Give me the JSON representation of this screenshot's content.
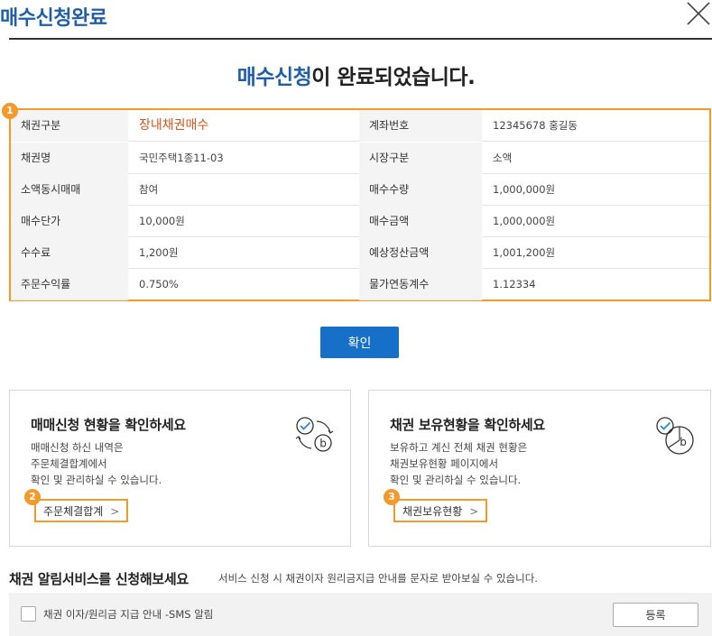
{
  "header": {
    "title": "매수신청완료",
    "close_icon": "close-icon"
  },
  "headline": {
    "accent": "매수신청",
    "rest": "이 완료되었습니다."
  },
  "info": {
    "badge": "1",
    "rows": [
      {
        "label1": "채권구분",
        "value1": "장내채권매수",
        "label2": "계좌번호",
        "value2": "12345678 홍길동"
      },
      {
        "label1": "채권명",
        "value1": "국민주택1종11-03",
        "label2": "시장구분",
        "value2": "소액"
      },
      {
        "label1": "소액동시매매",
        "value1": "참여",
        "label2": "매수수량",
        "value2": "1,000,000원"
      },
      {
        "label1": "매수단가",
        "value1": "10,000원",
        "label2": "매수금액",
        "value2": "1,000,000원"
      },
      {
        "label1": "수수료",
        "value1": "1,200원",
        "label2": "예상정산금액",
        "value2": "1,001,200원"
      },
      {
        "label1": "주문수익률",
        "value1": "0.750%",
        "label2": "물가연동계수",
        "value2": "1.12334"
      }
    ],
    "highlight_color": "#d9541e"
  },
  "confirm_label": "확인",
  "cards": [
    {
      "title": "매매신청 현황을 확인하세요",
      "desc": [
        "매매신청 하신 내역은",
        "주문체결합계에서",
        "확인 및 관리하실 수 있습니다."
      ],
      "link": "주문체결합계",
      "badge": "2",
      "icon": "check-bond-cycle-icon"
    },
    {
      "title": "채권 보유현황을 확인하세요",
      "desc": [
        "보유하고 계신 전체 채권 현황은",
        "채권보유현황 페이지에서",
        "확인 및 관리하실 수 있습니다."
      ],
      "link": "채권보유현황",
      "badge": "3",
      "icon": "check-bond-pie-icon"
    }
  ],
  "alarm": {
    "title": "채권 알림서비스를 신청해보세요",
    "desc": "서비스 신청 시 채권이자 원리금지급 안내를 문자로 받아보실 수 있습니다.",
    "checkbox_label": "채권 이자/원리금 지급 안내 -SMS 알림",
    "register_label": "등록"
  },
  "colors": {
    "brand": "#1f5fa8",
    "button": "#1770c8",
    "highlight": "#f39a2a"
  }
}
